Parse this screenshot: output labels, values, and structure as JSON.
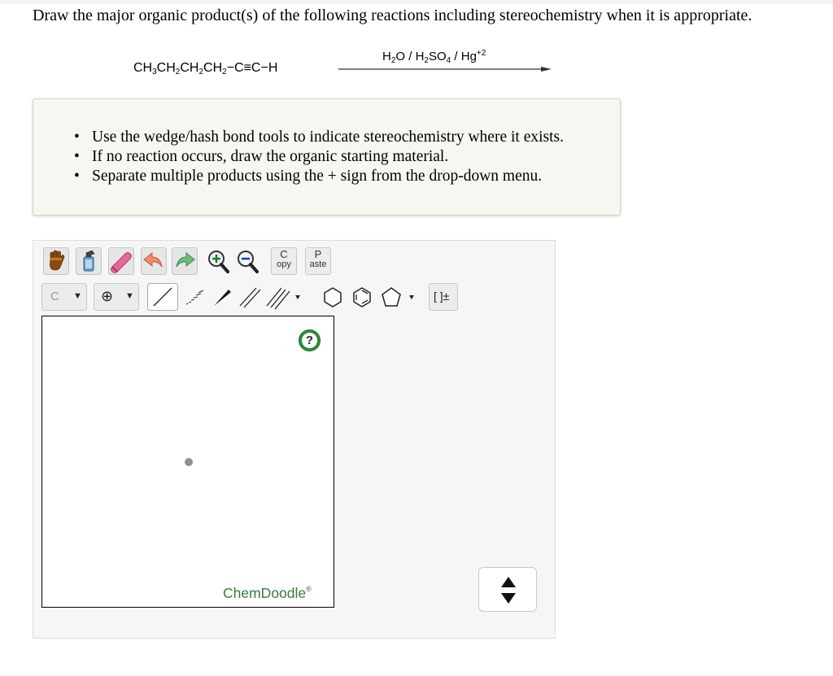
{
  "question": {
    "text": "Draw the major organic product(s) of the following reactions including stereochemistry when it is appropriate."
  },
  "reaction": {
    "reactant_parts": [
      "CH",
      "3",
      "CH",
      "2",
      "CH",
      "2",
      "CH",
      "2",
      "−C≡C−H"
    ],
    "reagent_parts": [
      "H",
      "2",
      "O / H",
      "2",
      "SO",
      "4",
      " / Hg",
      "+2"
    ]
  },
  "instructions": {
    "items": [
      "Use the wedge/hash bond tools to indicate stereochemistry where it exists.",
      "If no reaction occurs, draw the organic starting material.",
      "Separate multiple products using the + sign from the drop-down menu."
    ]
  },
  "toolbar": {
    "copy_top": "C",
    "copy_bottom": "opy",
    "paste_top": "P",
    "paste_bottom": "aste",
    "atom_label": "C",
    "charge_label": "⊕",
    "bracket_label": "[ ]±"
  },
  "canvas": {
    "help_label": "?",
    "brand": "ChemDoodle",
    "brand_mark": "®"
  },
  "colors": {
    "instructions_bg": "#f7f7f1",
    "editor_bg": "#f6f6f6",
    "help_green": "#2e8b3e",
    "brand_green": "#3a7a3a"
  }
}
